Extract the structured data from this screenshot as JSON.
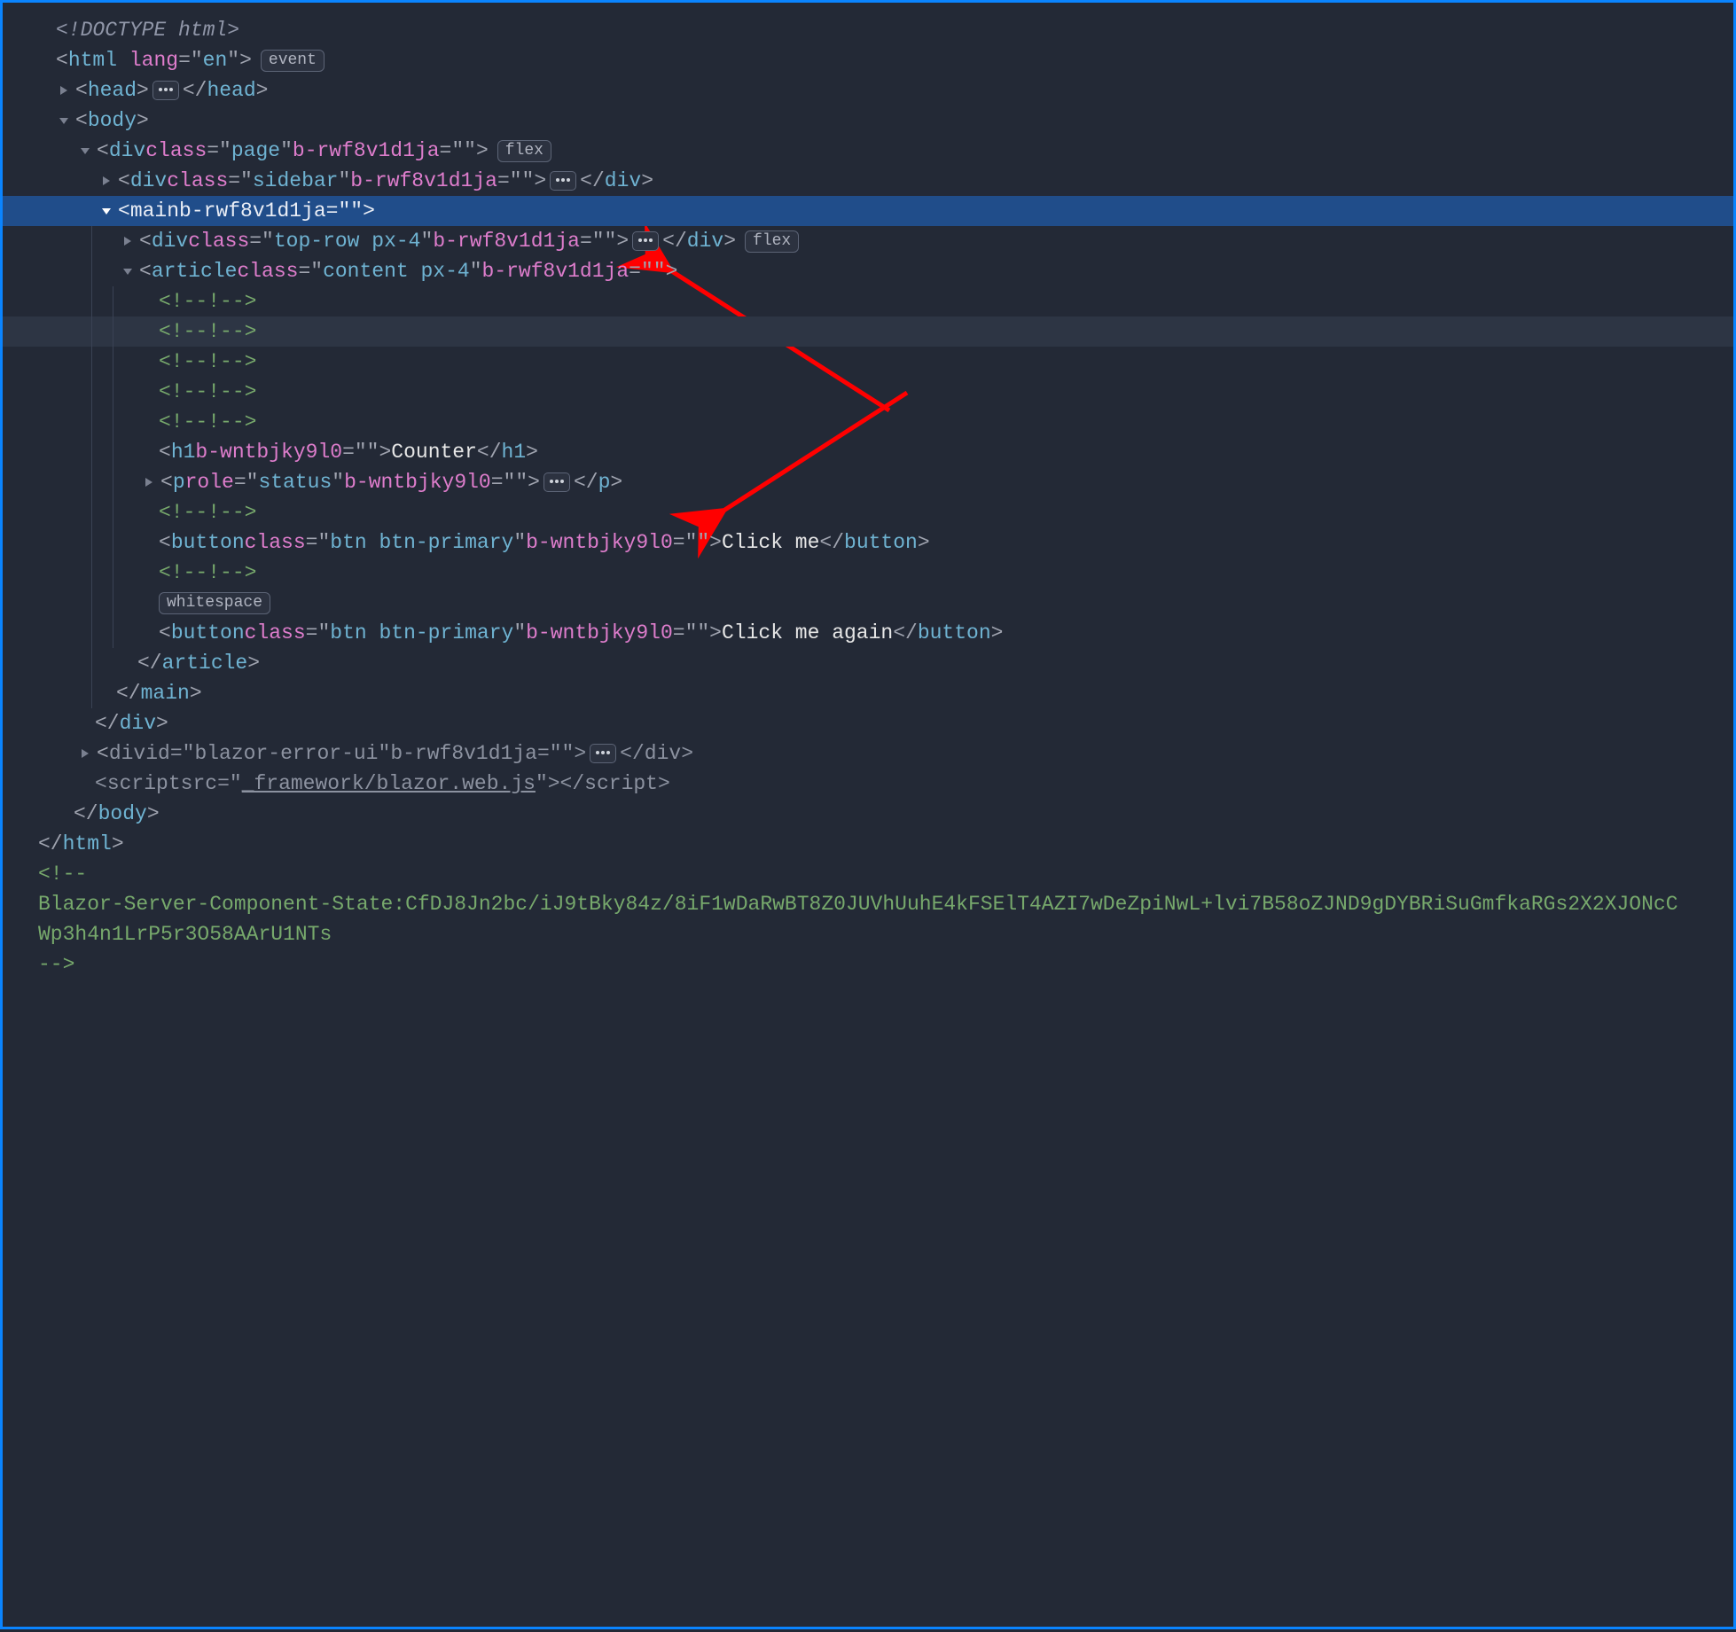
{
  "badges": {
    "event": "event",
    "flex": "flex",
    "whitespace": "whitespace"
  },
  "scope_attrs": {
    "a": "b-rwf8v1d1ja",
    "b": "b-wntbjky9l0"
  },
  "lines": {
    "doctype": "<!DOCTYPE html>",
    "html_open_tag": "html",
    "html_open_attr": "lang",
    "html_open_val": "en",
    "head_tag": "head",
    "body_tag": "body",
    "div_page_tag": "div",
    "div_page_class": "class",
    "div_page_class_v": "page",
    "div_sidebar_tag": "div",
    "div_sidebar_class_v": "sidebar",
    "main_tag": "main",
    "div_toprow_tag": "div",
    "div_toprow_class_v": "top-row px-4",
    "article_tag": "article",
    "article_class_v": "content px-4",
    "comment_marker": "<!--!-->",
    "h1_tag": "h1",
    "h1_text": "Counter",
    "p_tag": "p",
    "p_role_attr": "role",
    "p_role_val": "status",
    "button_tag": "button",
    "button_class_v": "btn btn-primary",
    "button_text_1": "Click me",
    "button_text_2": "Click me again",
    "article_close": "article",
    "main_close": "main",
    "div_close": "div",
    "error_div_tag": "div",
    "error_div_id_attr": "id",
    "error_div_id_val": "blazor-error-ui",
    "script_tag": "script",
    "script_src_attr": "src",
    "script_src_val": "_framework/blazor.web.js",
    "body_close": "body",
    "html_close": "html",
    "state_open": "<!--",
    "state_text": "Blazor-Server-Component-State:CfDJ8Jn2bc/iJ9tBky84z/8iF1wDaRwBT8Z0JUVhUuhE4kFSElT4AZI7wDeZpiNwL+lvi7B58oZJND9gDYBRiSuGmfkaRGs2X2XJONcCWp3h4n1LrP5r3O58AArU1NTs",
    "state_close": "-->"
  }
}
